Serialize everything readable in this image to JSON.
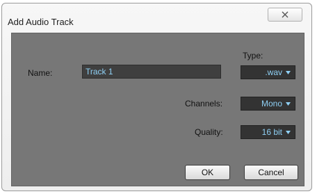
{
  "dialog": {
    "title": "Add Audio Track"
  },
  "form": {
    "name_label": "Name:",
    "name_value": "Track 1",
    "type_label": "Type:",
    "type_value": ".wav",
    "channels_label": "Channels:",
    "channels_value": "Mono",
    "quality_label": "Quality:",
    "quality_value": "16 bit"
  },
  "buttons": {
    "ok_label": "OK",
    "cancel_label": "Cancel"
  },
  "colors": {
    "panel_background": "#777777",
    "field_background": "#3f3f3f",
    "field_text": "#8fd0f5"
  },
  "icons": {
    "close": "close-x-icon",
    "dropdown": "caret-down-icon"
  }
}
